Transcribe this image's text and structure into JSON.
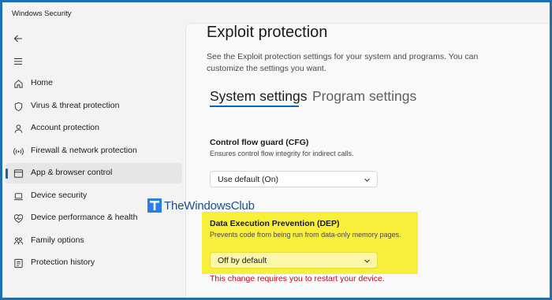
{
  "window": {
    "title": "Windows Security"
  },
  "sidebar": {
    "items": [
      {
        "label": "Home",
        "icon": "home-icon",
        "active": false
      },
      {
        "label": "Virus & threat protection",
        "icon": "shield-icon",
        "active": false
      },
      {
        "label": "Account protection",
        "icon": "person-icon",
        "active": false
      },
      {
        "label": "Firewall & network protection",
        "icon": "wireless-icon",
        "active": false
      },
      {
        "label": "App & browser control",
        "icon": "app-window-icon",
        "active": true
      },
      {
        "label": "Device security",
        "icon": "laptop-icon",
        "active": false
      },
      {
        "label": "Device performance & health",
        "icon": "heart-pulse-icon",
        "active": false
      },
      {
        "label": "Family options",
        "icon": "family-icon",
        "active": false
      },
      {
        "label": "Protection history",
        "icon": "history-icon",
        "active": false
      }
    ]
  },
  "main": {
    "title": "Exploit protection",
    "description": "See the Exploit protection settings for your system and programs.  You can customize the settings you want.",
    "tabs": [
      {
        "label": "System settings",
        "active": true
      },
      {
        "label": "Program settings",
        "active": false
      }
    ],
    "cfg": {
      "title": "Control flow guard (CFG)",
      "description": "Ensures control flow integrity for indirect calls.",
      "value": "Use default (On)"
    },
    "dep": {
      "title": "Data Execution Prevention (DEP)",
      "description": "Prevents code from being run from data-only memory pages.",
      "value": "Off by default"
    },
    "warning": "This change requires you to restart your device."
  },
  "watermark": {
    "text": "TheWindowsClub"
  },
  "colors": {
    "accent": "#0067c0",
    "highlight": "#f7ef39",
    "warning": "#c50f1f",
    "frame": "#1f6fb0"
  }
}
